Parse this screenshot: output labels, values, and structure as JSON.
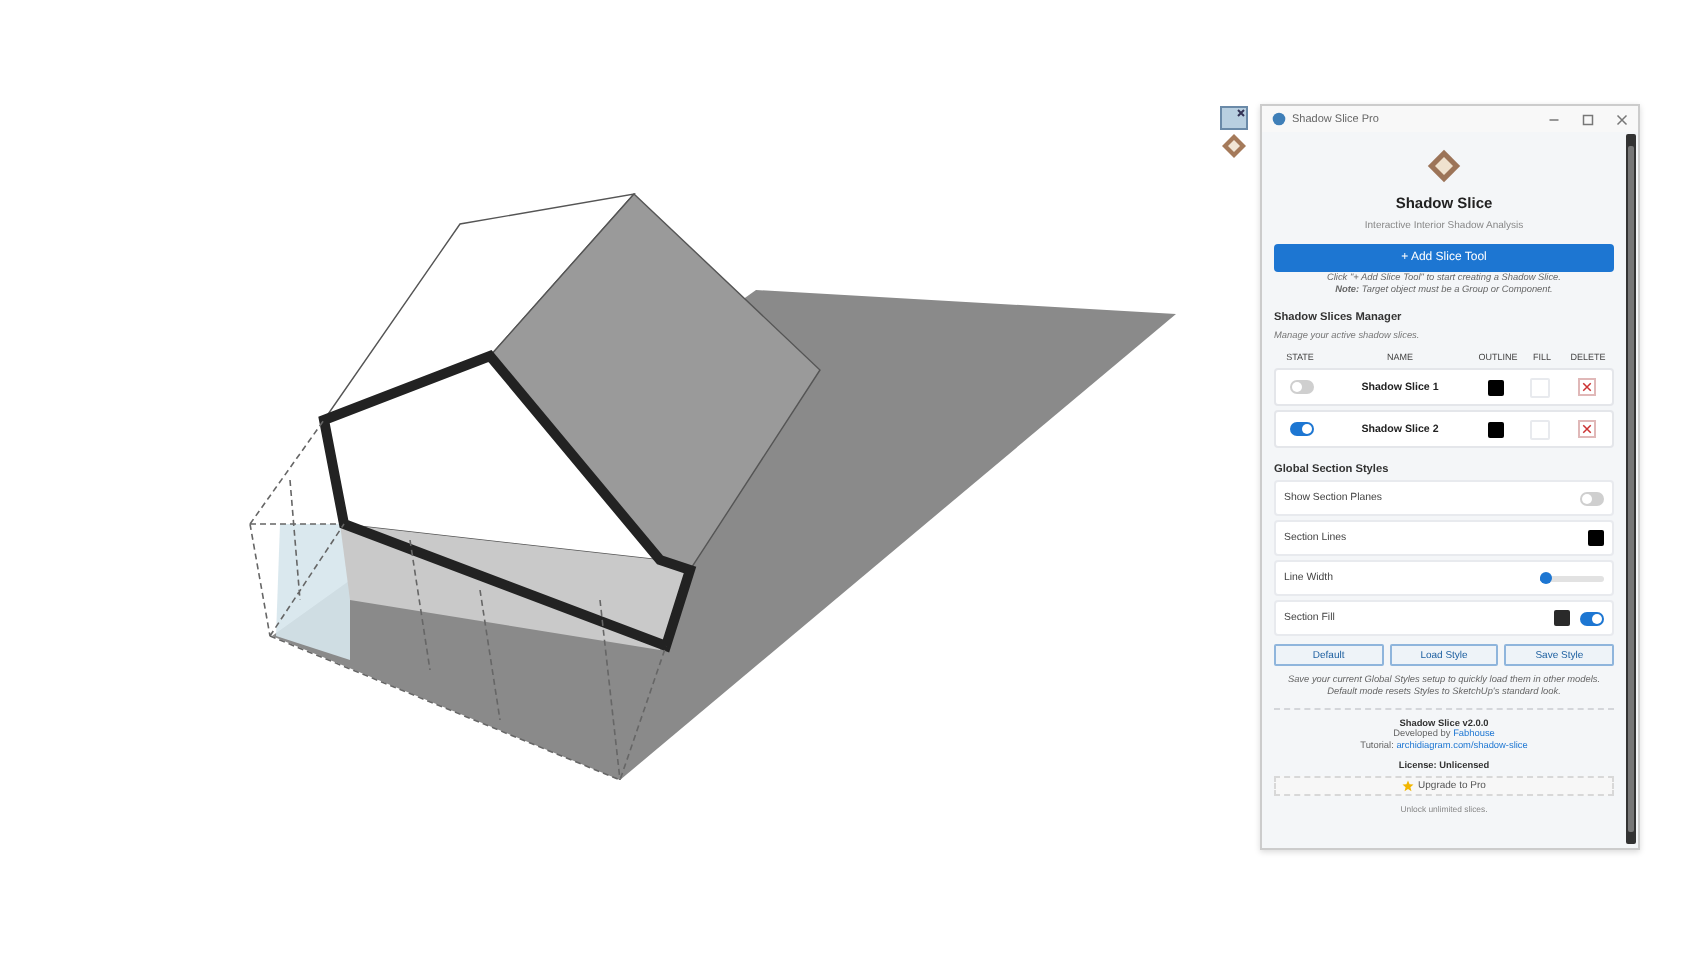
{
  "window": {
    "title": "Shadow Slice Pro"
  },
  "header": {
    "title": "Shadow Slice",
    "subtitle": "Interactive Interior Shadow Analysis"
  },
  "add_button": "+ Add Slice Tool",
  "hint": "Click \"+ Add Slice Tool\" to start creating a Shadow Slice.",
  "note": "**Note:** Target object must be a Group or Component.",
  "manager": {
    "title": "Shadow Slices Manager",
    "subtitle": "Manage your active shadow slices.",
    "columns": [
      "STATE",
      "NAME",
      "OUTLINE",
      "FILL",
      "DELETE"
    ],
    "slices": [
      {
        "name": "Shadow Slice 1",
        "on": false
      },
      {
        "name": "Shadow Slice 2",
        "on": true
      }
    ]
  },
  "global_styles": {
    "title": "Global Section Styles",
    "rows": [
      {
        "kind": "toggle",
        "label": "Show Section Planes",
        "on": false
      },
      {
        "kind": "swatch",
        "label": "Section Lines"
      },
      {
        "kind": "slider",
        "label": "Line Width",
        "level": 0.1
      },
      {
        "kind": "swatch_toggle",
        "label": "Section Fill",
        "on": true
      }
    ]
  },
  "style_buttons": [
    "Default",
    "Load Style",
    "Save Style"
  ],
  "style_note": "Save your current Global Styles setup to quickly load them in other models. Default mode resets Styles to SketchUp's standard look.",
  "footer": {
    "version": "Shadow Slice v2.0.0",
    "developed_by": "Developed by",
    "developer": "Fabhouse",
    "tutorial_label": "Tutorial:",
    "tutorial_link": "archidiagram.com/shadow-slice",
    "license": "License: Unlicensed",
    "upgrade_button": "Upgrade to Pro",
    "unlock_note": "Unlock unlimited slices."
  }
}
